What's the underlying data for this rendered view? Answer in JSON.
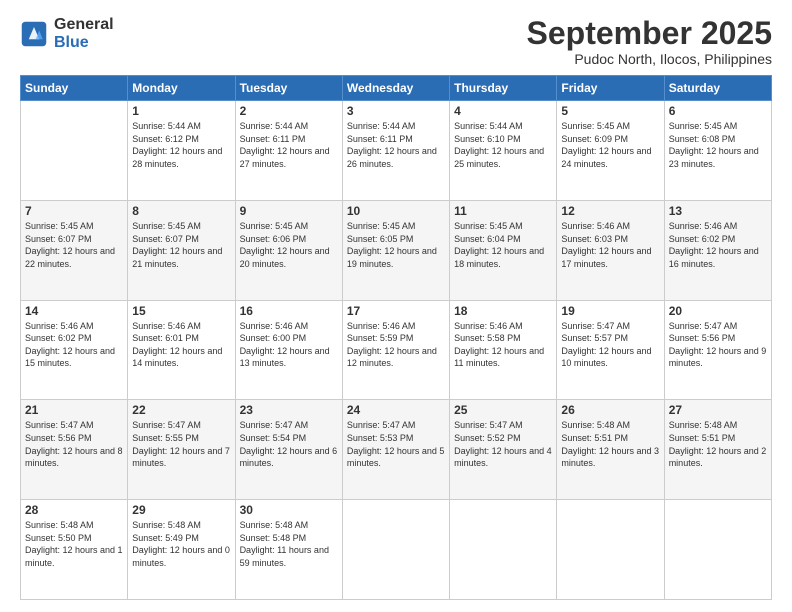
{
  "logo": {
    "general": "General",
    "blue": "Blue"
  },
  "title": {
    "month": "September 2025",
    "location": "Pudoc North, Ilocos, Philippines"
  },
  "weekdays": [
    "Sunday",
    "Monday",
    "Tuesday",
    "Wednesday",
    "Thursday",
    "Friday",
    "Saturday"
  ],
  "weeks": [
    [
      {
        "day": "",
        "sunrise": "",
        "sunset": "",
        "daylight": ""
      },
      {
        "day": "1",
        "sunrise": "Sunrise: 5:44 AM",
        "sunset": "Sunset: 6:12 PM",
        "daylight": "Daylight: 12 hours and 28 minutes."
      },
      {
        "day": "2",
        "sunrise": "Sunrise: 5:44 AM",
        "sunset": "Sunset: 6:11 PM",
        "daylight": "Daylight: 12 hours and 27 minutes."
      },
      {
        "day": "3",
        "sunrise": "Sunrise: 5:44 AM",
        "sunset": "Sunset: 6:11 PM",
        "daylight": "Daylight: 12 hours and 26 minutes."
      },
      {
        "day": "4",
        "sunrise": "Sunrise: 5:44 AM",
        "sunset": "Sunset: 6:10 PM",
        "daylight": "Daylight: 12 hours and 25 minutes."
      },
      {
        "day": "5",
        "sunrise": "Sunrise: 5:45 AM",
        "sunset": "Sunset: 6:09 PM",
        "daylight": "Daylight: 12 hours and 24 minutes."
      },
      {
        "day": "6",
        "sunrise": "Sunrise: 5:45 AM",
        "sunset": "Sunset: 6:08 PM",
        "daylight": "Daylight: 12 hours and 23 minutes."
      }
    ],
    [
      {
        "day": "7",
        "sunrise": "Sunrise: 5:45 AM",
        "sunset": "Sunset: 6:07 PM",
        "daylight": "Daylight: 12 hours and 22 minutes."
      },
      {
        "day": "8",
        "sunrise": "Sunrise: 5:45 AM",
        "sunset": "Sunset: 6:07 PM",
        "daylight": "Daylight: 12 hours and 21 minutes."
      },
      {
        "day": "9",
        "sunrise": "Sunrise: 5:45 AM",
        "sunset": "Sunset: 6:06 PM",
        "daylight": "Daylight: 12 hours and 20 minutes."
      },
      {
        "day": "10",
        "sunrise": "Sunrise: 5:45 AM",
        "sunset": "Sunset: 6:05 PM",
        "daylight": "Daylight: 12 hours and 19 minutes."
      },
      {
        "day": "11",
        "sunrise": "Sunrise: 5:45 AM",
        "sunset": "Sunset: 6:04 PM",
        "daylight": "Daylight: 12 hours and 18 minutes."
      },
      {
        "day": "12",
        "sunrise": "Sunrise: 5:46 AM",
        "sunset": "Sunset: 6:03 PM",
        "daylight": "Daylight: 12 hours and 17 minutes."
      },
      {
        "day": "13",
        "sunrise": "Sunrise: 5:46 AM",
        "sunset": "Sunset: 6:02 PM",
        "daylight": "Daylight: 12 hours and 16 minutes."
      }
    ],
    [
      {
        "day": "14",
        "sunrise": "Sunrise: 5:46 AM",
        "sunset": "Sunset: 6:02 PM",
        "daylight": "Daylight: 12 hours and 15 minutes."
      },
      {
        "day": "15",
        "sunrise": "Sunrise: 5:46 AM",
        "sunset": "Sunset: 6:01 PM",
        "daylight": "Daylight: 12 hours and 14 minutes."
      },
      {
        "day": "16",
        "sunrise": "Sunrise: 5:46 AM",
        "sunset": "Sunset: 6:00 PM",
        "daylight": "Daylight: 12 hours and 13 minutes."
      },
      {
        "day": "17",
        "sunrise": "Sunrise: 5:46 AM",
        "sunset": "Sunset: 5:59 PM",
        "daylight": "Daylight: 12 hours and 12 minutes."
      },
      {
        "day": "18",
        "sunrise": "Sunrise: 5:46 AM",
        "sunset": "Sunset: 5:58 PM",
        "daylight": "Daylight: 12 hours and 11 minutes."
      },
      {
        "day": "19",
        "sunrise": "Sunrise: 5:47 AM",
        "sunset": "Sunset: 5:57 PM",
        "daylight": "Daylight: 12 hours and 10 minutes."
      },
      {
        "day": "20",
        "sunrise": "Sunrise: 5:47 AM",
        "sunset": "Sunset: 5:56 PM",
        "daylight": "Daylight: 12 hours and 9 minutes."
      }
    ],
    [
      {
        "day": "21",
        "sunrise": "Sunrise: 5:47 AM",
        "sunset": "Sunset: 5:56 PM",
        "daylight": "Daylight: 12 hours and 8 minutes."
      },
      {
        "day": "22",
        "sunrise": "Sunrise: 5:47 AM",
        "sunset": "Sunset: 5:55 PM",
        "daylight": "Daylight: 12 hours and 7 minutes."
      },
      {
        "day": "23",
        "sunrise": "Sunrise: 5:47 AM",
        "sunset": "Sunset: 5:54 PM",
        "daylight": "Daylight: 12 hours and 6 minutes."
      },
      {
        "day": "24",
        "sunrise": "Sunrise: 5:47 AM",
        "sunset": "Sunset: 5:53 PM",
        "daylight": "Daylight: 12 hours and 5 minutes."
      },
      {
        "day": "25",
        "sunrise": "Sunrise: 5:47 AM",
        "sunset": "Sunset: 5:52 PM",
        "daylight": "Daylight: 12 hours and 4 minutes."
      },
      {
        "day": "26",
        "sunrise": "Sunrise: 5:48 AM",
        "sunset": "Sunset: 5:51 PM",
        "daylight": "Daylight: 12 hours and 3 minutes."
      },
      {
        "day": "27",
        "sunrise": "Sunrise: 5:48 AM",
        "sunset": "Sunset: 5:51 PM",
        "daylight": "Daylight: 12 hours and 2 minutes."
      }
    ],
    [
      {
        "day": "28",
        "sunrise": "Sunrise: 5:48 AM",
        "sunset": "Sunset: 5:50 PM",
        "daylight": "Daylight: 12 hours and 1 minute."
      },
      {
        "day": "29",
        "sunrise": "Sunrise: 5:48 AM",
        "sunset": "Sunset: 5:49 PM",
        "daylight": "Daylight: 12 hours and 0 minutes."
      },
      {
        "day": "30",
        "sunrise": "Sunrise: 5:48 AM",
        "sunset": "Sunset: 5:48 PM",
        "daylight": "Daylight: 11 hours and 59 minutes."
      },
      {
        "day": "",
        "sunrise": "",
        "sunset": "",
        "daylight": ""
      },
      {
        "day": "",
        "sunrise": "",
        "sunset": "",
        "daylight": ""
      },
      {
        "day": "",
        "sunrise": "",
        "sunset": "",
        "daylight": ""
      },
      {
        "day": "",
        "sunrise": "",
        "sunset": "",
        "daylight": ""
      }
    ]
  ]
}
